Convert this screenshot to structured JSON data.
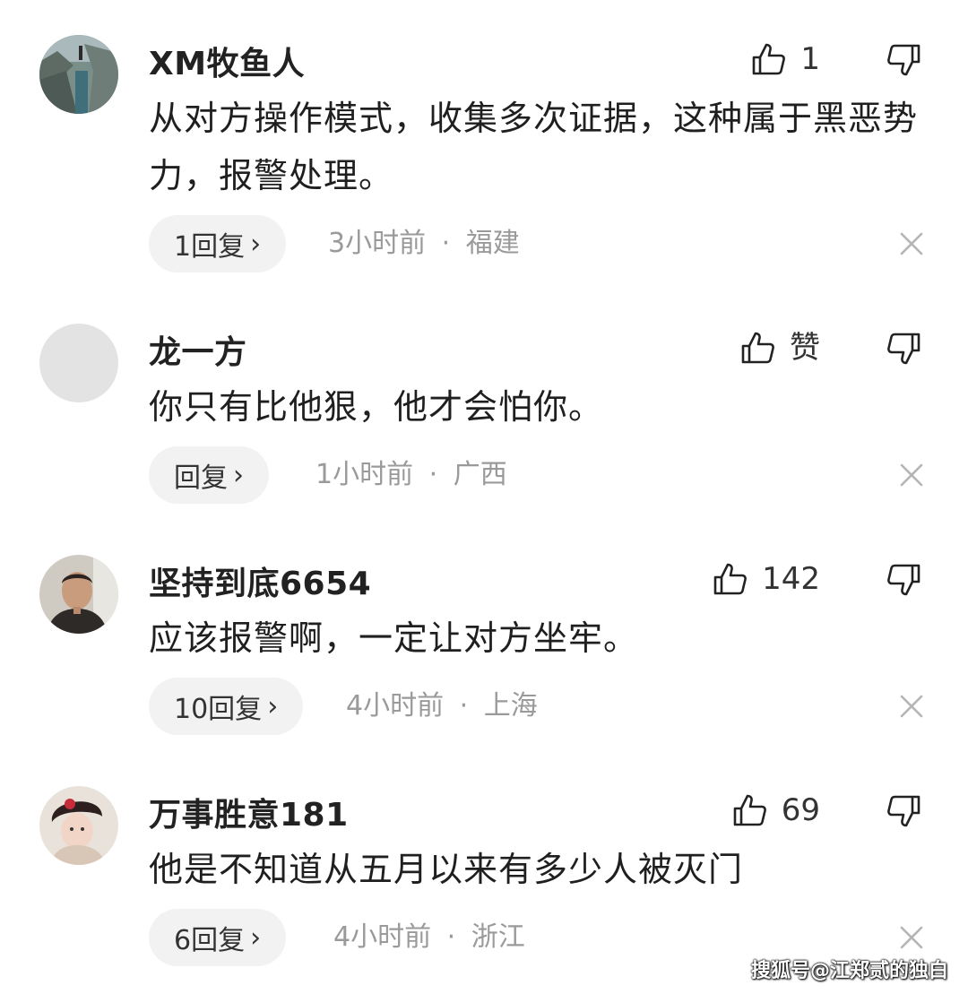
{
  "comments": [
    {
      "username": "XM牧鱼人",
      "like_count": "1",
      "text": "从对方操作模式，收集多次证据，这种属于黑恶势力，报警处理。",
      "reply_label": "1回复",
      "time": "3小时前",
      "location": "福建",
      "avatar_icon": "landscape-photo-avatar"
    },
    {
      "username": "龙一方",
      "like_count": "赞",
      "text": "你只有比他狠，他才会怕你。",
      "reply_label": "回复",
      "time": "1小时前",
      "location": "广西",
      "avatar_icon": "blank-gray-avatar"
    },
    {
      "username": "坚持到底6654",
      "like_count": "142",
      "text": "应该报警啊，一定让对方坐牢。",
      "reply_label": "10回复",
      "time": "4小时前",
      "location": "上海",
      "avatar_icon": "man-portrait-avatar"
    },
    {
      "username": "万事胜意181",
      "like_count": "69",
      "text": "他是不知道从五月以来有多少人被灭门",
      "reply_label": "6回复",
      "time": "4小时前",
      "location": "浙江",
      "avatar_icon": "child-portrait-avatar"
    }
  ],
  "separator": "·",
  "reply_chevron": "›",
  "watermark": "搜狐号@江郑贰的独白",
  "colors": {
    "meta_text": "#9a9a9a",
    "reply_bg": "#f2f2f2",
    "icon_stroke": "#222222"
  }
}
